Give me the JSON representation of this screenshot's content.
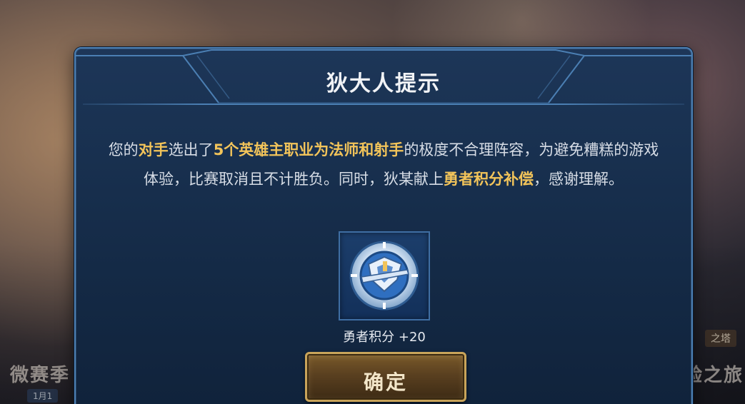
{
  "background": {
    "left_text": "微赛季",
    "left_badge": "1月1",
    "right_text": "验之旅",
    "right_tag": "之塔"
  },
  "dialog": {
    "title": "狄大人提示",
    "message_parts": {
      "p1": "您的",
      "p2": "对手",
      "p3": "选出了",
      "p4": "5个英雄主职业为法师和射手",
      "p5": "的极度不合理阵容，为避免糟糕的游戏体验，比赛取消且不计胜负。同时，狄某献上",
      "p6": "勇者积分补偿",
      "p7": "，感谢理解。"
    },
    "reward": {
      "icon": "brave-points-medal-icon",
      "label": "勇者积分 +20"
    },
    "confirm_label": "确定"
  },
  "colors": {
    "highlight": "#f2c45a",
    "panel": "#18304f",
    "border": "#4b7fb3",
    "button_border": "#c9a45a"
  }
}
